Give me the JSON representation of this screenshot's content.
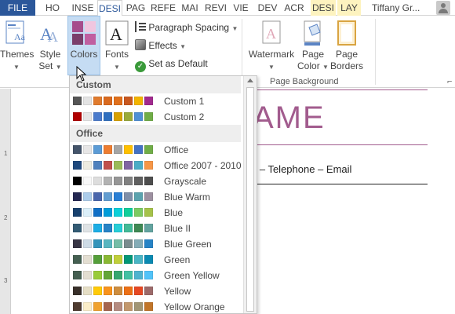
{
  "tabs": [
    {
      "label": "FILE",
      "kind": "file"
    },
    {
      "label": "HO"
    },
    {
      "label": "INSE"
    },
    {
      "label": "DESI",
      "active": true
    },
    {
      "label": "PAG"
    },
    {
      "label": "REFE"
    },
    {
      "label": "MAI"
    },
    {
      "label": "REVI"
    },
    {
      "label": "VIE"
    },
    {
      "label": "DEV"
    },
    {
      "label": "ACR"
    },
    {
      "label": "DESI",
      "kind": "ctx"
    },
    {
      "label": "LAY",
      "kind": "ctx"
    }
  ],
  "user": {
    "name": "Tiffany Gr..."
  },
  "ribbon": {
    "themes": "Themes",
    "style_set_1": "Style",
    "style_set_2": "Set",
    "colors": "Colors",
    "fonts": "Fonts",
    "paragraph_spacing": "Paragraph Spacing",
    "effects": "Effects",
    "set_default": "Set as Default",
    "watermark": "Watermark",
    "page_color_1": "Page",
    "page_color_2": "Color",
    "page_borders_1": "Page",
    "page_borders_2": "Borders",
    "group_page_background": "Page Background"
  },
  "document": {
    "name_text": "AME",
    "contact_text": "e – Telephone – Email"
  },
  "ruler_marks": [
    "1",
    "2",
    "3"
  ],
  "dropdown": {
    "sections": [
      {
        "title": "Custom",
        "items": [
          {
            "name": "Custom 1",
            "colors": [
              "#555555",
              "#e3e3e3",
              "#e07b2e",
              "#d96a1f",
              "#e0701c",
              "#c8581f",
              "#f3b400",
              "#a12a8e"
            ]
          },
          {
            "name": "Custom 2",
            "colors": [
              "#b00000",
              "#e6e6e6",
              "#4b7bcc",
              "#2f6fbf",
              "#d8a100",
              "#9aaa3a",
              "#4e8fd6",
              "#70ad47"
            ]
          }
        ]
      },
      {
        "title": "Office",
        "items": [
          {
            "name": "Office",
            "colors": [
              "#44546a",
              "#e7e6e6",
              "#5b9bd5",
              "#ed7d31",
              "#a5a5a5",
              "#ffc000",
              "#4472c4",
              "#70ad47"
            ]
          },
          {
            "name": "Office 2007 - 2010",
            "colors": [
              "#1f497d",
              "#eeece1",
              "#4f81bd",
              "#c0504d",
              "#9bbb59",
              "#8064a2",
              "#4bacc6",
              "#f79646"
            ]
          },
          {
            "name": "Grayscale",
            "colors": [
              "#000000",
              "#f8f8f8",
              "#dddddd",
              "#b2b2b2",
              "#969696",
              "#808080",
              "#5f5f5f",
              "#4d4d4d"
            ]
          },
          {
            "name": "Blue Warm",
            "colors": [
              "#242852",
              "#acccea",
              "#4a66ac",
              "#629dd1",
              "#297fd5",
              "#7f8fa9",
              "#5aa2ae",
              "#9d90a0"
            ]
          },
          {
            "name": "Blue",
            "colors": [
              "#17406d",
              "#dbeff9",
              "#0f6fc6",
              "#009dd9",
              "#0bd0d9",
              "#10cf9b",
              "#7cca62",
              "#a5c249"
            ]
          },
          {
            "name": "Blue II",
            "colors": [
              "#335b74",
              "#dfe3e5",
              "#1cade4",
              "#2683c6",
              "#27ced7",
              "#42ba97",
              "#3e8853",
              "#62a39f"
            ]
          },
          {
            "name": "Blue Green",
            "colors": [
              "#373545",
              "#cedbe6",
              "#3494ba",
              "#58b6c0",
              "#75bda7",
              "#7a8c8e",
              "#84acb6",
              "#2683c6"
            ]
          },
          {
            "name": "Green",
            "colors": [
              "#455f51",
              "#e3ded1",
              "#549e39",
              "#8ab833",
              "#c0cf3a",
              "#029676",
              "#4ab5c4",
              "#0989b1"
            ]
          },
          {
            "name": "Green Yellow",
            "colors": [
              "#455f51",
              "#e3ded1",
              "#99cb38",
              "#63a537",
              "#37a76f",
              "#44c1a3",
              "#4eb3cf",
              "#51c3f9"
            ]
          },
          {
            "name": "Yellow",
            "colors": [
              "#39302a",
              "#e5dec5",
              "#ffca08",
              "#f8931d",
              "#ce8d3e",
              "#ec7016",
              "#e64823",
              "#9c6a6a"
            ]
          },
          {
            "name": "Yellow Orange",
            "colors": [
              "#4e3b30",
              "#fbeec9",
              "#f0a22e",
              "#a5644e",
              "#b58b80",
              "#c3986d",
              "#a19574",
              "#c17529"
            ]
          }
        ]
      }
    ]
  }
}
